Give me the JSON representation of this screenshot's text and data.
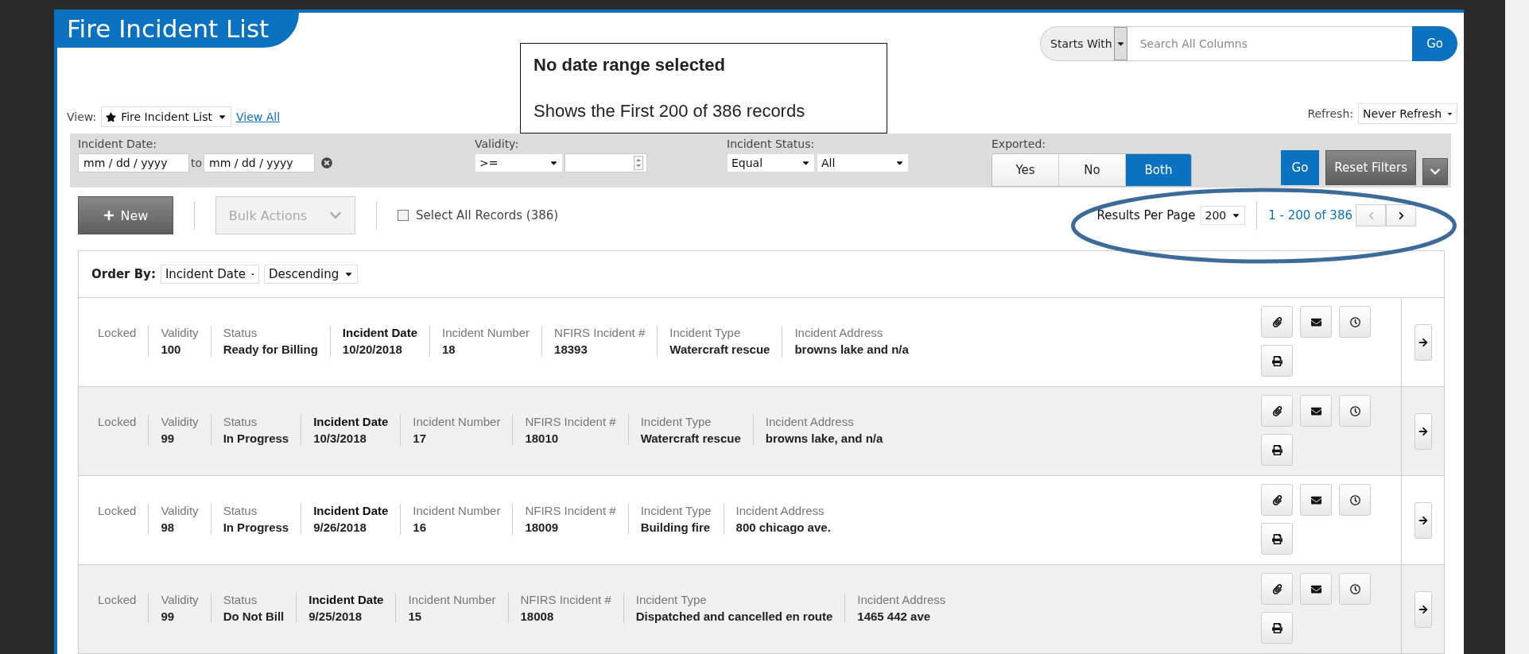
{
  "page": {
    "title": "Fire Incident List"
  },
  "annotation": {
    "heading": "No date range selected",
    "text": "Shows the First 200 of 386 records"
  },
  "search": {
    "mode": "Starts With",
    "placeholder": "Search All Columns",
    "button": "Go"
  },
  "view": {
    "label": "View:",
    "value": "Fire Incident List",
    "link": "View All"
  },
  "refresh": {
    "label": "Refresh:",
    "value": "Never Refresh"
  },
  "filters": {
    "incident_date": {
      "label": "Incident Date:",
      "from_placeholder": "mm / dd / yyyy",
      "separator": "to",
      "to_placeholder": "mm / dd / yyyy"
    },
    "validity": {
      "label": "Validity:",
      "operator": ">="
    },
    "incident_status": {
      "label": "Incident Status:",
      "operator": "Equal",
      "value": "All"
    },
    "exported": {
      "label": "Exported:",
      "options": [
        {
          "label": "Yes",
          "selected": false
        },
        {
          "label": "No",
          "selected": false
        },
        {
          "label": "Both",
          "selected": true
        }
      ]
    },
    "go": "Go",
    "reset": "Reset Filters"
  },
  "toolbar": {
    "new": "New",
    "bulk_actions": {
      "label": "Bulk Actions",
      "disabled": true
    },
    "select_all": {
      "label": "Select All Records (386)",
      "checked": false
    },
    "results_per_page": {
      "label": "Results Per Page",
      "value": "200"
    },
    "range": "1 - 200 of 386",
    "prev_disabled": true
  },
  "order_by": {
    "label": "Order By:",
    "field": "Incident Date",
    "direction": "Descending"
  },
  "rows": [
    {
      "cells": [
        {
          "label": "Locked",
          "emphasized": false
        },
        {
          "label": "Validity",
          "value": "100",
          "emphasized": false
        },
        {
          "label": "Status",
          "value": "Ready for Billing",
          "emphasized": false
        },
        {
          "label": "Incident Date",
          "value": "10/20/2018",
          "emphasized": true
        },
        {
          "label": "Incident Number",
          "value": "18",
          "emphasized": false
        },
        {
          "label": "NFIRS Incident #",
          "value": "18393",
          "emphasized": false
        },
        {
          "label": "Incident Type",
          "value": "Watercraft rescue",
          "emphasized": false
        },
        {
          "label": "Incident Address",
          "value": "browns lake and n/a",
          "emphasized": false
        }
      ]
    },
    {
      "cells": [
        {
          "label": "Locked",
          "emphasized": false
        },
        {
          "label": "Validity",
          "value": "99",
          "emphasized": false
        },
        {
          "label": "Status",
          "value": "In Progress",
          "emphasized": false
        },
        {
          "label": "Incident Date",
          "value": "10/3/2018",
          "emphasized": true
        },
        {
          "label": "Incident Number",
          "value": "17",
          "emphasized": false
        },
        {
          "label": "NFIRS Incident #",
          "value": "18010",
          "emphasized": false
        },
        {
          "label": "Incident Type",
          "value": "Watercraft rescue",
          "emphasized": false
        },
        {
          "label": "Incident Address",
          "value": "browns lake, and n/a",
          "emphasized": false
        }
      ]
    },
    {
      "cells": [
        {
          "label": "Locked",
          "emphasized": false
        },
        {
          "label": "Validity",
          "value": "98",
          "emphasized": false
        },
        {
          "label": "Status",
          "value": "In Progress",
          "emphasized": false
        },
        {
          "label": "Incident Date",
          "value": "9/26/2018",
          "emphasized": true
        },
        {
          "label": "Incident Number",
          "value": "16",
          "emphasized": false
        },
        {
          "label": "NFIRS Incident #",
          "value": "18009",
          "emphasized": false
        },
        {
          "label": "Incident Type",
          "value": "Building fire",
          "emphasized": false
        },
        {
          "label": "Incident Address",
          "value": "800 chicago ave.",
          "emphasized": false
        }
      ]
    },
    {
      "cells": [
        {
          "label": "Locked",
          "emphasized": false
        },
        {
          "label": "Validity",
          "value": "99",
          "emphasized": false
        },
        {
          "label": "Status",
          "value": "Do Not Bill",
          "emphasized": false
        },
        {
          "label": "Incident Date",
          "value": "9/25/2018",
          "emphasized": true
        },
        {
          "label": "Incident Number",
          "value": "15",
          "emphasized": false
        },
        {
          "label": "NFIRS Incident #",
          "value": "18008",
          "emphasized": false
        },
        {
          "label": "Incident Type",
          "value": "Dispatched and cancelled en route",
          "emphasized": false
        },
        {
          "label": "Incident Address",
          "value": "1465 442 ave",
          "emphasized": false
        }
      ]
    }
  ]
}
